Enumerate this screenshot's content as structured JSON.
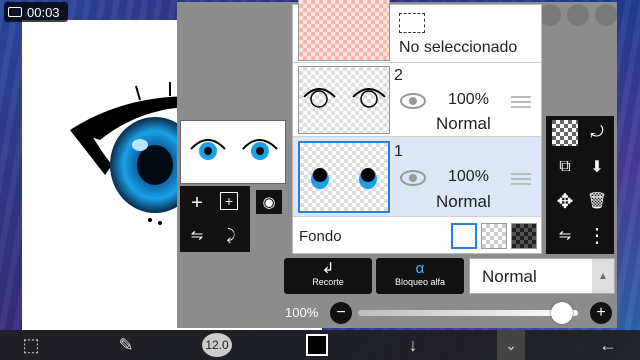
{
  "recording": {
    "time": "00:03"
  },
  "layers_panel": {
    "layers": [
      {
        "id": "none",
        "name": "No seleccionado"
      },
      {
        "id": "layer2",
        "number": "2",
        "opacity": "100%",
        "blend": "Normal"
      },
      {
        "id": "layer1",
        "number": "1",
        "opacity": "100%",
        "blend": "Normal",
        "selected": true
      }
    ],
    "background": {
      "label": "Fondo"
    }
  },
  "actions": {
    "clip_label": "Recorte",
    "alpha_lock_label": "Bloqueo alfa",
    "blend_mode": "Normal",
    "opacity_label": "100%",
    "opacity_value": 1.0
  },
  "bottom_toolbar": {
    "brush_size": "12.0"
  },
  "colors": {
    "selection_blue": "#2a7fdc",
    "eye_blue": "#1aa0e6",
    "panel_gray": "#8c8c8c",
    "current_color": "#000000"
  },
  "icons": {
    "add_layer": "plus-icon",
    "add_from_layer": "add-layer-copy-icon",
    "camera": "camera-icon",
    "flip_h": "flip-horizontal-icon",
    "rotate": "rotate-icon",
    "transparency": "checker-icon",
    "rotate_layer": "rotate-layer-icon",
    "select": "select-icon",
    "merge_down": "merge-down-icon",
    "move": "move-icon",
    "delete": "trash-icon",
    "more": "more-icon",
    "back": "back-arrow-icon"
  }
}
